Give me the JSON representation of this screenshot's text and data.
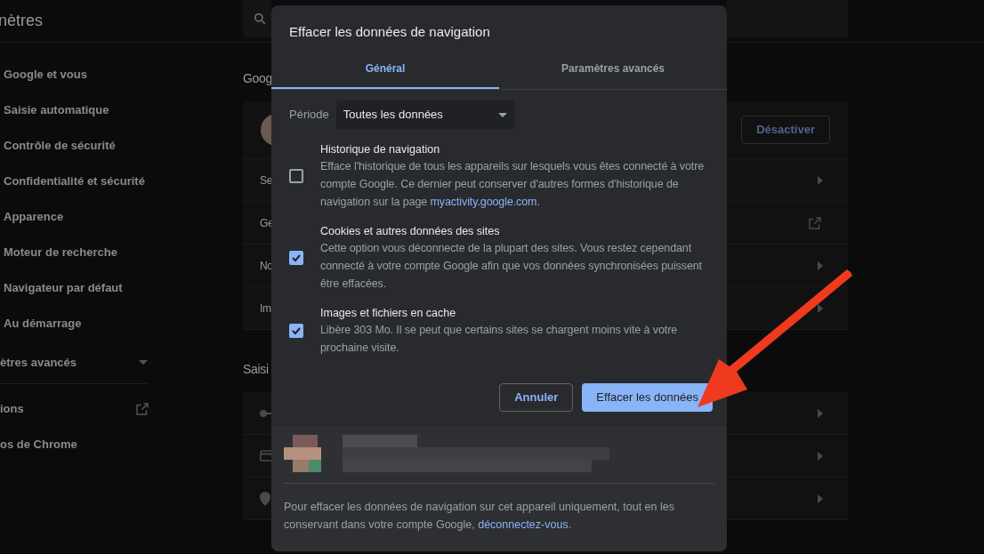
{
  "sidebar": {
    "title": "nètres",
    "items": [
      {
        "label": "Google et vous"
      },
      {
        "label": "Saisie automatique"
      },
      {
        "label": "Contrôle de sécurité"
      },
      {
        "label": "Confidentialité et sécurité"
      },
      {
        "label": "Apparence"
      },
      {
        "label": "Moteur de recherche"
      },
      {
        "label": "Navigateur par défaut"
      },
      {
        "label": "Au démarrage"
      }
    ],
    "advanced": {
      "label": "ètres avancés"
    },
    "links": [
      {
        "label": "ions",
        "kind": "external"
      },
      {
        "label": "os de Chrome",
        "kind": "plain"
      }
    ]
  },
  "main": {
    "sections": [
      {
        "heading": "Goog",
        "rows": [
          {
            "kind": "account",
            "button": "Désactiver"
          },
          {
            "kind": "subpage",
            "label": "Se"
          },
          {
            "kind": "external",
            "label": "Ge"
          },
          {
            "kind": "subpage",
            "label": "No"
          },
          {
            "kind": "subpage",
            "label": "Im"
          }
        ]
      },
      {
        "heading": "Saisi",
        "rows": [
          {
            "kind": "key"
          },
          {
            "kind": "card"
          },
          {
            "kind": "pin"
          }
        ]
      }
    ]
  },
  "dialog": {
    "title": "Effacer les données de navigation",
    "tabs": [
      {
        "label": "Général",
        "selected": true
      },
      {
        "label": "Paramètres avancés",
        "selected": false
      }
    ],
    "period": {
      "label": "Période",
      "value": "Toutes les données"
    },
    "options": [
      {
        "title": "Historique de navigation",
        "description": "Efface l'historique de tous les appareils sur lesquels vous êtes connecté à votre compte Google. Ce dernier peut conserver d'autres formes d'historique de navigation sur la page ",
        "link": "myactivity.google.com",
        "description_end": ".",
        "checked": false
      },
      {
        "title": "Cookies et autres données des sites",
        "description": "Cette option vous déconnecte de la plupart des sites. Vous restez cependant connecté à votre compte Google afin que vos données synchronisées puissent être effacées.",
        "checked": true
      },
      {
        "title": "Images et fichiers en cache",
        "description": "Libère 303 Mo. Il se peut que certains sites se chargent moins vite à votre prochaine visite.",
        "checked": true
      }
    ],
    "buttons": {
      "cancel": "Annuler",
      "confirm": "Effacer les données"
    },
    "footer": {
      "text": "Pour effacer les données de navigation sur cet appareil uniquement, tout en les conservant dans votre compte Google, ",
      "link": "déconnectez-vous",
      "text_end": "."
    }
  }
}
